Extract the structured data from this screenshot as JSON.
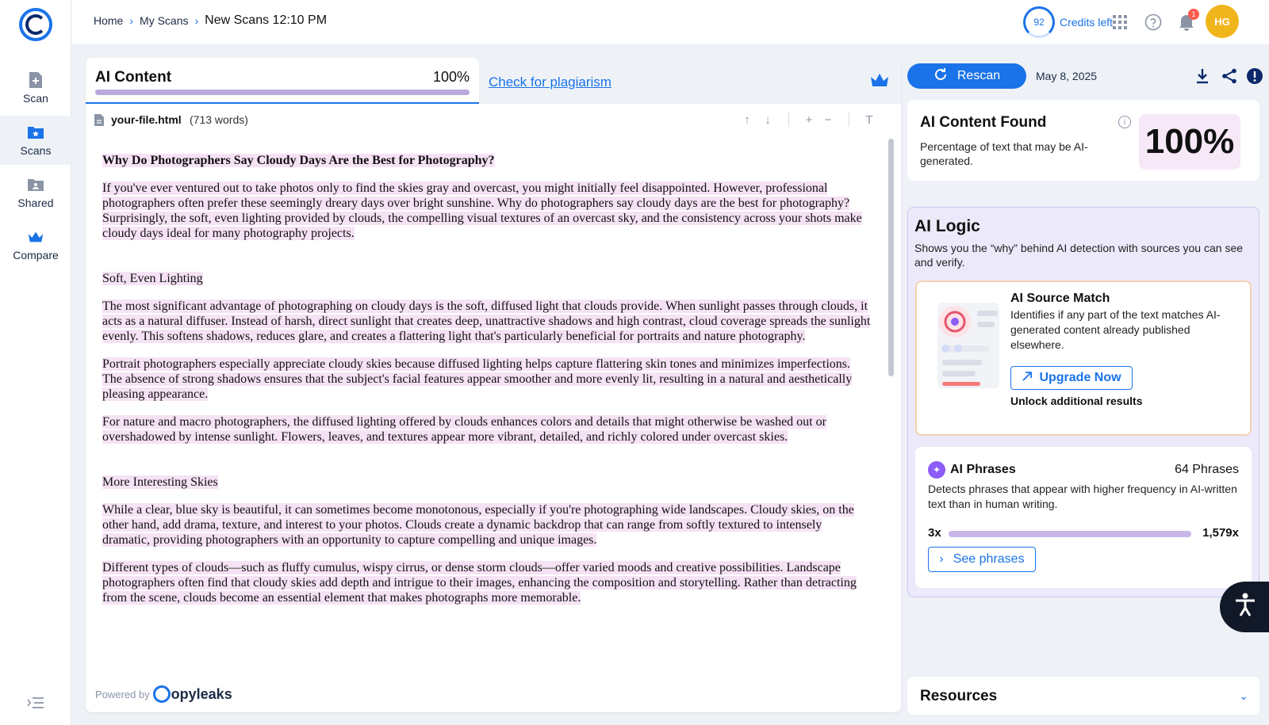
{
  "sidebar": {
    "items": [
      {
        "label": "Scan",
        "icon": "add-file-icon"
      },
      {
        "label": "Scans",
        "icon": "star-folder-icon"
      },
      {
        "label": "Shared",
        "icon": "shared-folder-icon"
      },
      {
        "label": "Compare",
        "icon": "crown-icon"
      }
    ]
  },
  "breadcrumb": {
    "home": "Home",
    "scans": "My Scans",
    "current": "New Scans 12:10 PM"
  },
  "header": {
    "credits_value": "92",
    "credits_label": "Credits left",
    "notification_count": "1",
    "avatar_initials": "HG"
  },
  "tabs": {
    "ai_title": "AI Content",
    "ai_percent": "100%",
    "ai_progress": 1.0,
    "plagiarism_link": "Check for plagiarism"
  },
  "file": {
    "name": "your-file.html",
    "words": "(713 words)"
  },
  "document": {
    "title": "Why Do Photographers Say Cloudy Days Are the Best for Photography?",
    "p1": "If you've ever ventured out to take photos only to find the skies gray and overcast, you might initially feel disappointed. However, professional photographers often prefer these seemingly dreary days over bright sunshine. Why do photographers say cloudy days are the best for photography? Surprisingly, the soft, even lighting provided by clouds, the compelling visual textures of an overcast sky, and the consistency across your shots make cloudy days ideal for many photography projects.",
    "h2": "Soft, Even Lighting",
    "p2": "The most significant advantage of photographing on cloudy days is the soft, diffused light that clouds provide. When sunlight passes through clouds, it acts as a natural diffuser. Instead of harsh, direct sunlight that creates deep, unattractive shadows and high contrast, cloud coverage spreads the sunlight evenly. This softens shadows, reduces glare, and creates a flattering light that's particularly beneficial for portraits and nature photography.",
    "p3": "Portrait photographers especially appreciate cloudy skies because diffused lighting helps capture flattering skin tones and minimizes imperfections. The absence of strong shadows ensures that the subject's facial features appear smoother and more evenly lit, resulting in a natural and aesthetically pleasing appearance.",
    "p4": "For nature and macro photographers, the diffused lighting offered by clouds enhances colors and details that might otherwise be washed out or overshadowed by intense sunlight. Flowers, leaves, and textures appear more vibrant, detailed, and richly colored under overcast skies.",
    "h3": "More Interesting Skies",
    "p5": "While a clear, blue sky is beautiful, it can sometimes become monotonous, especially if you're photographing wide landscapes. Cloudy skies, on the other hand, add drama, texture, and interest to your photos. Clouds create a dynamic backdrop that can range from softly textured to intensely dramatic, providing photographers with an opportunity to capture compelling and unique images.",
    "p6": "Different types of clouds—such as fluffy cumulus, wispy cirrus, or dense storm clouds—offer varied moods and creative possibilities. Landscape photographers often find that cloudy skies add depth and intrigue to their images, enhancing the composition and storytelling. Rather than detracting from the scene, clouds become an essential element that makes photographs more memorable."
  },
  "footer": {
    "powered_by": "Powered by",
    "brand": "opyleaks"
  },
  "right": {
    "rescan_label": "Rescan",
    "date": "May 8, 2025",
    "found_title": "AI Content Found",
    "found_desc": "Percentage of text that may be AI-generated.",
    "found_pct": "100%",
    "logic_title": "AI Logic",
    "logic_desc": "Shows you the “why” behind AI detection with sources you can see and verify.",
    "source_title": "AI Source Match",
    "source_desc": "Identifies if any part of the text matches AI-generated content already published elsewhere.",
    "upgrade_label": "Upgrade Now",
    "unlock_label": "Unlock additional results",
    "phrases_title": "AI Phrases",
    "phrases_count": "64 Phrases",
    "phrases_desc": "Detects phrases that appear with higher frequency in AI-written text than in human writing.",
    "phrases_min": "3x",
    "phrases_max": "1,579x",
    "see_phrases_label": "See phrases",
    "resources_title": "Resources"
  },
  "colors": {
    "accent": "#1a73e8",
    "highlight": "#f6e2f5",
    "logic_bg": "#ece9fb",
    "avatar": "#f1b51c"
  }
}
